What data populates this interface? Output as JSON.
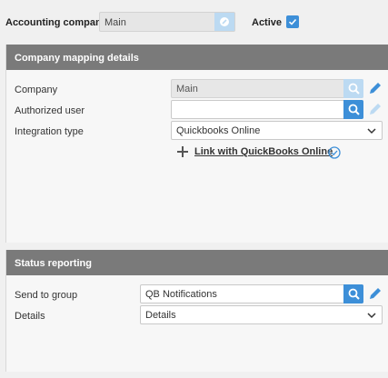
{
  "header": {
    "accounting_company_label": "Accounting company",
    "accounting_company_value": "Main",
    "active_label": "Active",
    "active_checked": true
  },
  "company_mapping": {
    "title": "Company mapping details",
    "company_label": "Company",
    "company_value": "Main",
    "authorized_user_label": "Authorized user",
    "authorized_user_value": "",
    "integration_type_label": "Integration type",
    "integration_type_value": "Quickbooks Online",
    "link_label": "Link with QuickBooks Online"
  },
  "status_reporting": {
    "title": "Status reporting",
    "send_to_group_label": "Send to group",
    "send_to_group_value": "QB Notifications",
    "details_label": "Details",
    "details_value": "Details"
  },
  "colors": {
    "accent": "#3d8fd8",
    "accent_light": "#bcdaf2",
    "header_bg": "#7a7a7a"
  }
}
